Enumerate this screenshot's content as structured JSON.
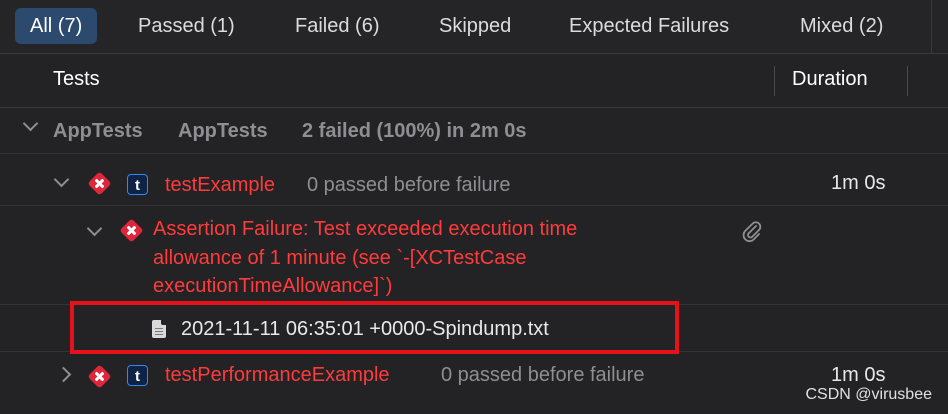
{
  "tabs": [
    {
      "label": "All (7)",
      "active": true
    },
    {
      "label": "Passed (1)",
      "active": false
    },
    {
      "label": "Failed (6)",
      "active": false
    },
    {
      "label": "Skipped",
      "active": false
    },
    {
      "label": "Expected Failures",
      "active": false
    },
    {
      "label": "Mixed (2)",
      "active": false
    }
  ],
  "header": {
    "tests": "Tests",
    "duration": "Duration"
  },
  "group": {
    "name": "AppTests",
    "target": "AppTests",
    "summary": "2 failed (100%) in 2m 0s"
  },
  "tests": [
    {
      "name": "testExample",
      "detail": "0 passed before failure",
      "duration": "1m 0s",
      "expanded": true,
      "status": "failed"
    },
    {
      "name": "testPerformanceExample",
      "detail": "0 passed before failure",
      "duration": "1m 0s",
      "expanded": false,
      "status": "failed"
    }
  ],
  "assertion": {
    "line1": "Assertion Failure: Test exceeded execution time",
    "line2": "allowance of 1 minute (see `-[XCTestCase",
    "line3": "executionTimeAllowance]`)"
  },
  "attachment": {
    "filename": "2021-11-11 06:35:01 +0000-Spindump.txt"
  },
  "watermark": "CSDN @virusbee",
  "colors": {
    "failure": "#ff3b3b",
    "highlight": "#e5121b",
    "activeTab": "#2c4a6e"
  }
}
